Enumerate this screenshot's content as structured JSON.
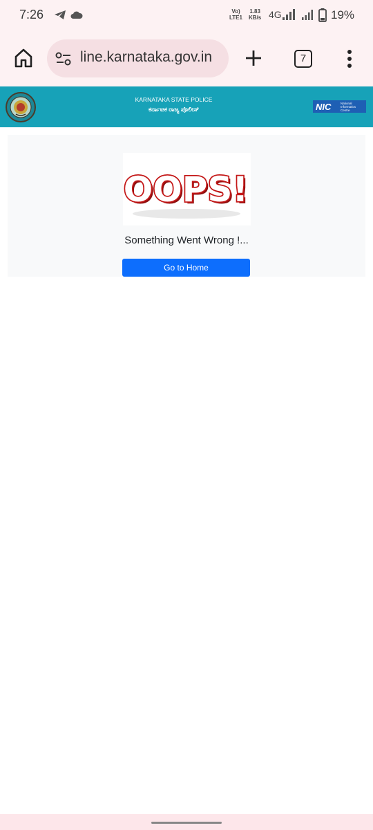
{
  "status_bar": {
    "time": "7:26",
    "volte_line1": "Vo)",
    "volte_line2": "LTE1",
    "speed_value": "1.83",
    "speed_unit": "KB/s",
    "network": "4G",
    "battery": "19%"
  },
  "browser": {
    "url": "line.karnataka.gov.in",
    "tab_count": "7",
    "icons": [
      "home-icon",
      "tune-icon",
      "plus-icon",
      "tab-switcher-icon",
      "more-vert-icon"
    ]
  },
  "site_header": {
    "title_en": "KARNATAKA STATE POLICE",
    "title_kn": "ಕರ್ನಾಟಕ ರಾಜ್ಯ ಪೊಲೀಸ್",
    "nic_logo": "NIC",
    "nic_text_1": "National",
    "nic_text_2": "Informatics",
    "nic_text_3": "Centre",
    "background_color": "#17a2b8"
  },
  "error": {
    "image_text": "OOPS!",
    "message": "Something Went Wrong !...",
    "home_button_label": "Go to Home",
    "button_color": "#0d6efd"
  }
}
